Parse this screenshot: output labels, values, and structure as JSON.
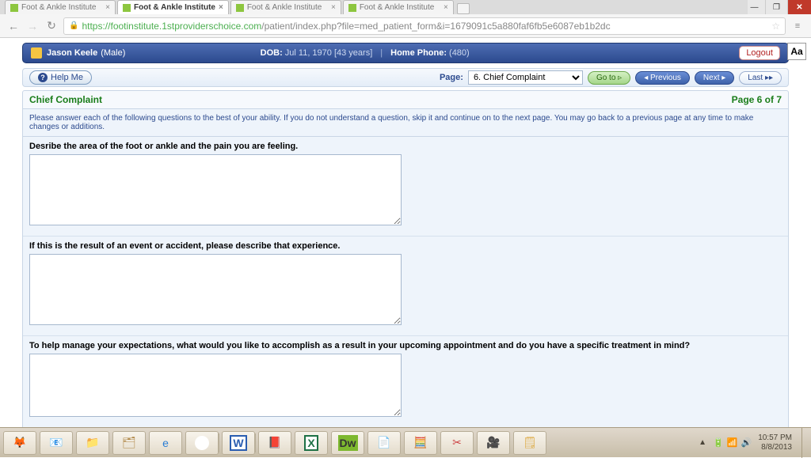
{
  "window": {
    "tabs": [
      {
        "title": "Foot & Ankle Institute"
      },
      {
        "title": "Foot & Ankle Institute"
      },
      {
        "title": "Foot & Ankle Institute"
      },
      {
        "title": "Foot & Ankle Institute"
      }
    ],
    "active_tab": 1
  },
  "url": {
    "proto": "https://",
    "host": "footinstitute.1stproviderschoice.com",
    "path": "/patient/index.php?file=med_patient_form&i=1679091c5a880faf6fb5e6087eb1b2dc"
  },
  "patient": {
    "name": "Jason Keele",
    "gender": "(Male)",
    "dob_label": "DOB:",
    "dob": "Jul 11, 1970  [43 years]",
    "phone_label": "Home Phone:",
    "phone": "(480)",
    "logout": "Logout"
  },
  "subbar": {
    "help": "Help Me",
    "page_label": "Page:",
    "page_select": "6. Chief Complaint",
    "goto": "Go to ▹",
    "prev": "◂ Previous",
    "next": "Next ▸",
    "last": "Last ▸▸"
  },
  "section": {
    "title": "Chief Complaint",
    "pageno": "Page 6 of 7",
    "instructions": "Please answer each of the following questions to the best of your ability. If you do not understand a question, skip it and continue on to the next page. You may go back to a previous page at any time to make changes or additions."
  },
  "questions": {
    "q1": "Desribe the area of the foot or ankle and the pain you are feeling.",
    "q2": "If this is the result of an event or accident, please describe that experience.",
    "q3": "To help manage your expectations, what would you like to accomplish as a result in your upcoming appointment and do you have a specific treatment in mind?"
  },
  "aa": "Aa",
  "tray": {
    "time": "10:57 PM",
    "date": "8/8/2013",
    "up": "▲"
  }
}
